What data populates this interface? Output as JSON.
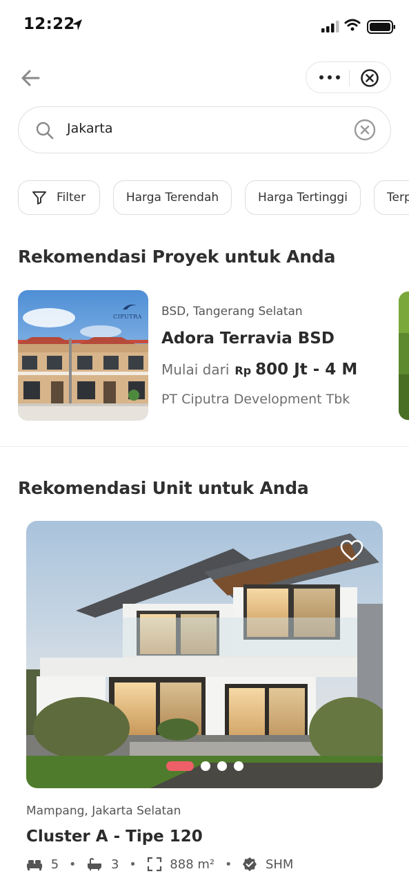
{
  "status_bar": {
    "time": "12:22"
  },
  "search": {
    "value": "Jakarta"
  },
  "chips": [
    {
      "label": "Filter"
    },
    {
      "label": "Harga Terendah"
    },
    {
      "label": "Harga Tertinggi"
    },
    {
      "label": "Terp"
    }
  ],
  "projects": {
    "section_title": "Rekomendasi Proyek untuk Anda",
    "items": [
      {
        "logo_text": "CIPUTRA",
        "location": "BSD, Tangerang Selatan",
        "name": "Adora Terravia BSD",
        "price_prefix": "Mulai dari",
        "currency": "Rp",
        "price_range": "800 Jt - 4 M",
        "developer": "PT Ciputra Development Tbk"
      }
    ]
  },
  "units": {
    "section_title": "Rekomendasi Unit untuk Anda",
    "items": [
      {
        "carousel_count": 4,
        "carousel_active": 0,
        "location": "Mampang, Jakarta Selatan",
        "name": "Cluster A - Tipe 120",
        "bedrooms": "5",
        "bathrooms": "3",
        "area": "888 m²",
        "certificate": "SHM"
      }
    ]
  },
  "colors": {
    "accent": "#ef5f67",
    "text": "#2b2b2b",
    "muted": "#6d6d6d",
    "border": "#dedede"
  }
}
